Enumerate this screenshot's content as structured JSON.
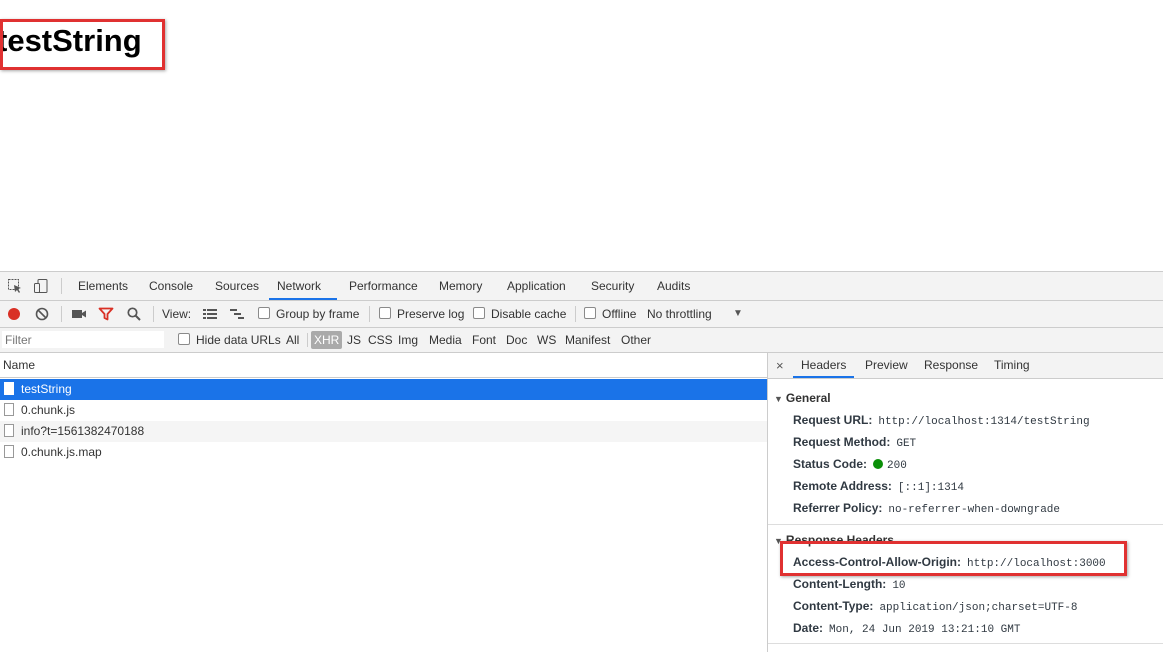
{
  "page": {
    "heading": "testString"
  },
  "devtools": {
    "tabs": [
      "Elements",
      "Console",
      "Sources",
      "Network",
      "Performance",
      "Memory",
      "Application",
      "Security",
      "Audits"
    ],
    "active_tab": "Network",
    "toolbar": {
      "view_label": "View:",
      "group_by_frame": "Group by frame",
      "preserve_log": "Preserve log",
      "disable_cache": "Disable cache",
      "offline": "Offline",
      "throttling": "No throttling"
    },
    "filter": {
      "placeholder": "Filter",
      "hide_data_urls": "Hide data URLs",
      "types": [
        "All",
        "XHR",
        "JS",
        "CSS",
        "Img",
        "Media",
        "Font",
        "Doc",
        "WS",
        "Manifest",
        "Other"
      ],
      "selected_type": "XHR"
    },
    "requests": {
      "column_name": "Name",
      "rows": [
        "testString",
        "0.chunk.js",
        "info?t=1561382470188",
        "0.chunk.js.map"
      ],
      "selected": "testString"
    },
    "detail": {
      "close": "×",
      "tabs": [
        "Headers",
        "Preview",
        "Response",
        "Timing"
      ],
      "active_tab": "Headers",
      "general": {
        "title": "General",
        "items": [
          {
            "key": "Request URL:",
            "value": "http://localhost:1314/testString"
          },
          {
            "key": "Request Method:",
            "value": "GET"
          },
          {
            "key": "Status Code:",
            "value": "200"
          },
          {
            "key": "Remote Address:",
            "value": "[::1]:1314"
          },
          {
            "key": "Referrer Policy:",
            "value": "no-referrer-when-downgrade"
          }
        ]
      },
      "response_headers": {
        "title": "Response Headers",
        "items": [
          {
            "key": "Access-Control-Allow-Origin:",
            "value": "http://localhost:3000"
          },
          {
            "key": "Content-Length:",
            "value": "10"
          },
          {
            "key": "Content-Type:",
            "value": "application/json;charset=UTF-8"
          },
          {
            "key": "Date:",
            "value": "Mon, 24 Jun 2019 13:21:10 GMT"
          }
        ]
      }
    }
  },
  "colors": {
    "highlight": "#e03131",
    "accent": "#1a73e8",
    "record": "#d93025",
    "filter_icon": "#d93025",
    "status_ok": "#0a8f08"
  }
}
